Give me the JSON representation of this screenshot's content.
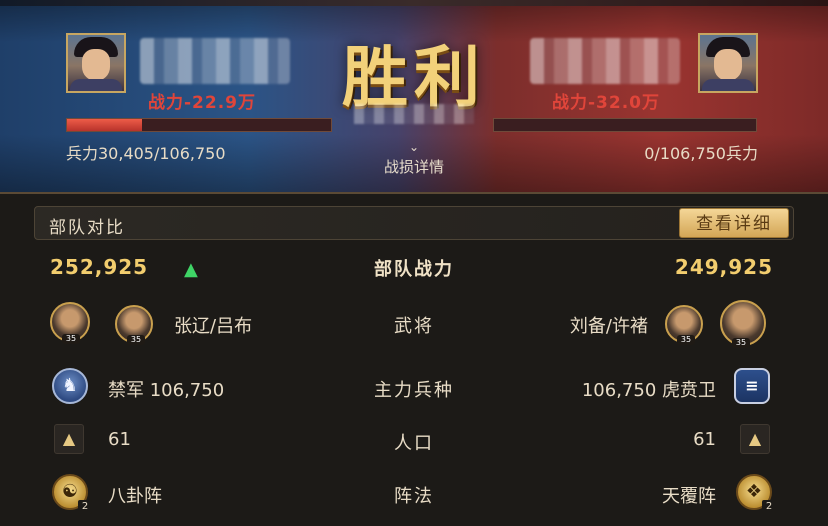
{
  "header": {
    "victory_text": "胜利",
    "detail_link_label": "战损详情",
    "left": {
      "power_loss": "战力-22.9万",
      "troops": "兵力30,405/106,750",
      "bar_fraction": 0.285
    },
    "right": {
      "power_loss": "战力-32.0万",
      "troops": "0/106,750兵力",
      "bar_fraction": 0.0
    }
  },
  "section": {
    "title": "部队对比",
    "detail_button": "查看详细"
  },
  "compare": {
    "power": {
      "left": "252,925",
      "label": "部队战力",
      "right": "249,925",
      "left_arrow": "▲",
      "arrow_color": "#3fd466"
    },
    "generals": {
      "label": "武将",
      "left": "张辽/吕布",
      "right": "刘备/许褚",
      "left_heroes": [
        {
          "level": "35",
          "icon": "general-portrait"
        },
        {
          "level": "35",
          "icon": "general-portrait"
        }
      ],
      "right_heroes": [
        {
          "level": "35",
          "icon": "general-portrait"
        },
        {
          "level": "35",
          "icon": "general-portrait"
        }
      ]
    },
    "unit": {
      "label": "主力兵种",
      "left": "禁军 106,750",
      "right": "106,750 虎贲卫",
      "left_icon": "horse-icon",
      "right_icon": "gate-icon"
    },
    "population": {
      "label": "人口",
      "left": "61",
      "right": "61",
      "icon": "helmet-icon"
    },
    "formation": {
      "label": "阵法",
      "left": "八卦阵",
      "right": "天覆阵",
      "left_count": "2",
      "right_count": "2",
      "icon": "formation-icon"
    }
  }
}
